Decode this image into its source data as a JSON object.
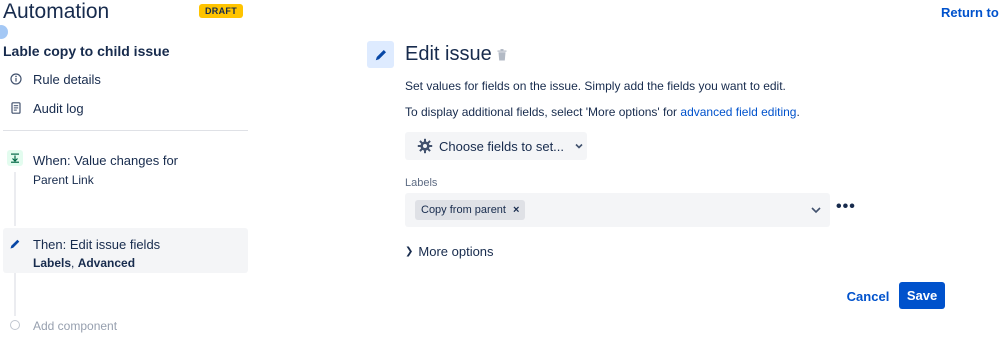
{
  "header": {
    "title": "Automation",
    "status_badge": "DRAFT",
    "return_link": "Return to li"
  },
  "sidebar": {
    "rule_name": "Lable copy to child issue",
    "links": [
      {
        "label": "Rule details",
        "icon": "info-icon"
      },
      {
        "label": "Audit log",
        "icon": "document-icon"
      }
    ],
    "components": {
      "trigger": {
        "title": "When: Value changes for",
        "subtitle": "Parent Link",
        "icon": "trigger-icon"
      },
      "action": {
        "title": "Then: Edit issue fields",
        "subtitle_bold1": "Labels",
        "subtitle_sep": ", ",
        "subtitle_bold2": "Advanced",
        "icon": "pencil-icon"
      },
      "add_component": "Add component"
    }
  },
  "main": {
    "title": "Edit issue",
    "description1": "Set values for fields on the issue. Simply add the fields you want to edit.",
    "description2_prefix": "To display additional fields, select 'More options' for ",
    "description2_link": "advanced field editing",
    "description2_suffix": ".",
    "choose_fields_button": "Choose fields to set...",
    "labels_field": {
      "caption": "Labels",
      "tags": [
        "Copy from parent"
      ],
      "remove_glyph": "×"
    },
    "more_options_dots": "•••",
    "more_options": "More options",
    "cancel": "Cancel",
    "save": "Save"
  },
  "colors": {
    "primary": "#0052cc",
    "draft_badge": "#ffc400",
    "text": "#172b4d",
    "subtle_bg": "#f4f5f7"
  }
}
